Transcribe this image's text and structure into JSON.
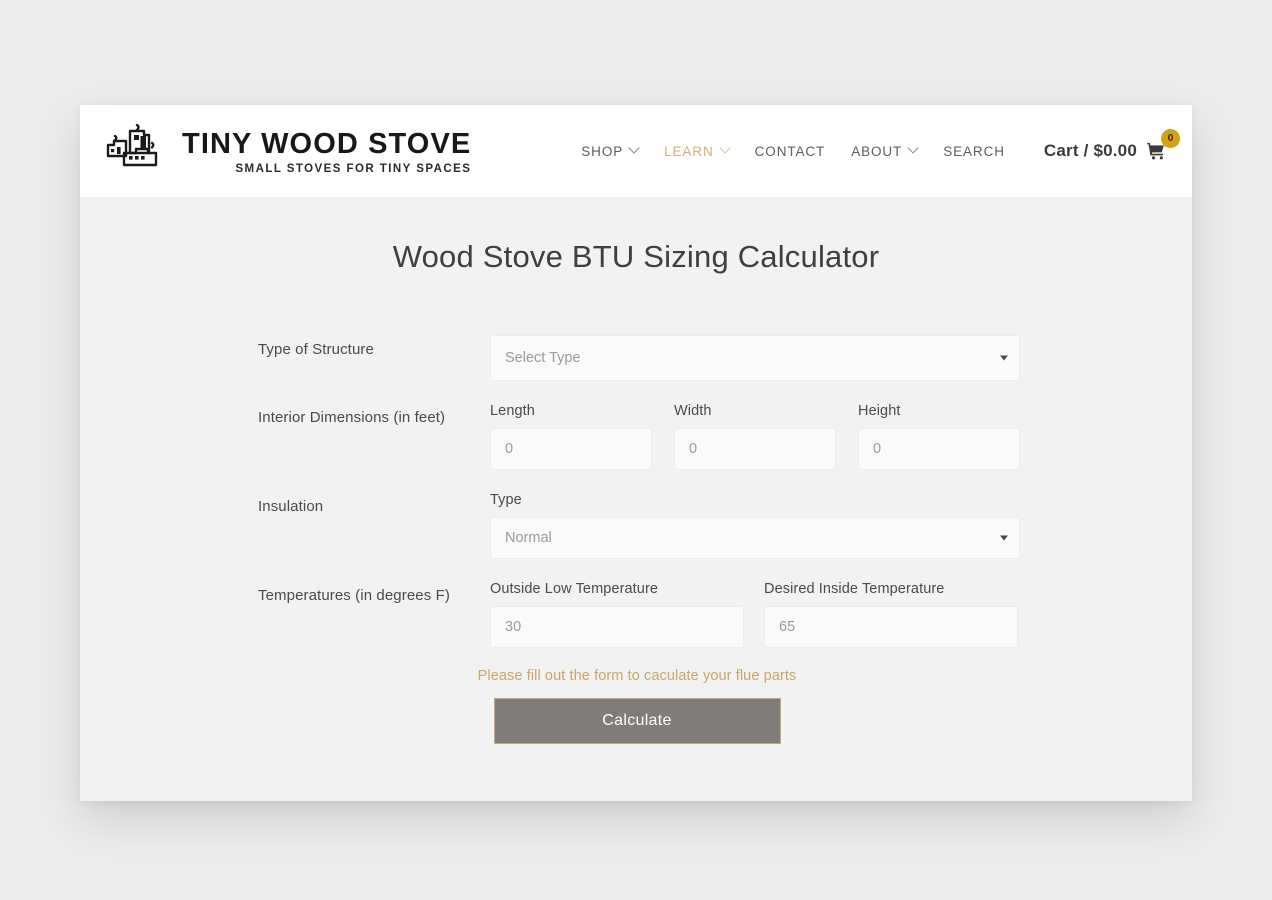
{
  "header": {
    "brand": {
      "title": "TINY WOOD STOVE",
      "tagline": "SMALL STOVES FOR TINY SPACES",
      "logo_icon": "tiny-stove-houses-icon"
    },
    "nav_items": [
      {
        "label": "SHOP",
        "has_dropdown": true,
        "active": false
      },
      {
        "label": "LEARN",
        "has_dropdown": true,
        "active": true
      },
      {
        "label": "CONTACT",
        "has_dropdown": false,
        "active": false
      },
      {
        "label": "ABOUT",
        "has_dropdown": true,
        "active": false
      },
      {
        "label": "SEARCH",
        "has_dropdown": false,
        "active": false
      }
    ],
    "cart": {
      "label": "Cart / $0.00",
      "badge_count": "0",
      "icon": "shopping-cart-icon",
      "badge_color": "#d4a017"
    },
    "active_nav_color": "#d0b276"
  },
  "main": {
    "title": "Wood Stove BTU Sizing Calculator",
    "rows": {
      "structure": {
        "label": "Type of Structure",
        "select_value": "Select Type"
      },
      "dimensions": {
        "label": "Interior Dimensions (in feet)",
        "fields": [
          {
            "label": "Length",
            "value": "0"
          },
          {
            "label": "Width",
            "value": "0"
          },
          {
            "label": "Height",
            "value": "0"
          }
        ]
      },
      "insulation": {
        "label": "Insulation",
        "field_label": "Type",
        "select_value": "Normal"
      },
      "temperatures": {
        "label": "Temperatures (in degrees F)",
        "fields": [
          {
            "label": "Outside Low Temperature",
            "value": "30"
          },
          {
            "label": "Desired Inside Temperature",
            "value": "65"
          }
        ]
      }
    },
    "note": "Please fill out the form to caculate your flue parts",
    "note_color": "#c9a56a",
    "calculate_label": "Calculate",
    "calculate_bg": "#7f7c79",
    "calculate_border": "#c4a97c"
  }
}
